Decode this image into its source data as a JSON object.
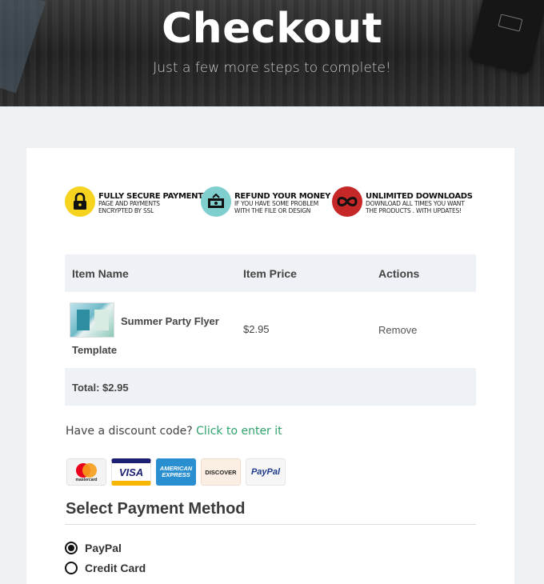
{
  "hero": {
    "title": "Checkout",
    "subtitle": "Just a few more steps to complete!"
  },
  "features": [
    {
      "icon": "lock-icon",
      "color": "#f5d31f",
      "title": "Fully Secure Payments",
      "line1": "Page and payments",
      "line2": "encrypted by SSL"
    },
    {
      "icon": "money-icon",
      "color": "#7fcfcf",
      "title": "Refund Your Money",
      "line1": "If you have some problem",
      "line2": "with the file or design"
    },
    {
      "icon": "infinity-icon",
      "color": "#c62828",
      "title": "Unlimited Downloads",
      "line1": "Download all times you want",
      "line2": "the products . with updates!"
    }
  ],
  "cart": {
    "headers": {
      "name": "Item Name",
      "price": "Item Price",
      "actions": "Actions"
    },
    "items": [
      {
        "name_line1": "Summer Party Flyer",
        "name_line2": "Template",
        "price": "$2.95",
        "action": "Remove"
      }
    ],
    "total": "Total: $2.95"
  },
  "discount": {
    "prompt": "Have a discount code?",
    "link": "Click to enter it"
  },
  "payment_logos": [
    {
      "name": "mastercard",
      "label": "mastercard"
    },
    {
      "name": "visa",
      "label": "VISA"
    },
    {
      "name": "american-express",
      "label": "AMERICAN EXPRESS"
    },
    {
      "name": "discover",
      "label": "DISCOVER"
    },
    {
      "name": "paypal",
      "label": "PayPal"
    }
  ],
  "payment_method": {
    "title": "Select Payment Method",
    "options": [
      {
        "label": "PayPal",
        "selected": true
      },
      {
        "label": "Credit Card",
        "selected": false
      }
    ]
  },
  "colors": {
    "accent_link": "#2ea36c",
    "page_bg": "#eef1f4",
    "table_header_bg": "#eef1f5"
  }
}
